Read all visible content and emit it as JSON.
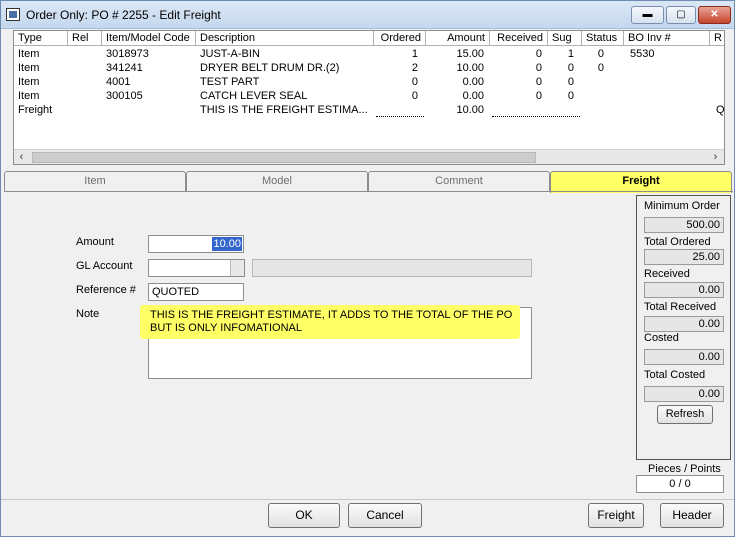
{
  "window": {
    "title": "Order Only: PO # 2255  - Edit Freight",
    "min_label": "▬",
    "max_label": "▢",
    "close_label": "✕"
  },
  "grid": {
    "columns": [
      "Type",
      "Rel",
      "Item/Model Code",
      "Description",
      "Ordered",
      "Amount",
      "Received",
      "Sug",
      "Status",
      "BO Inv #",
      "R"
    ],
    "rows": [
      {
        "type": "Item",
        "rel": "",
        "item_code": "3018973",
        "description": "JUST-A-BIN",
        "ordered": "1",
        "amount": "15.00",
        "received": "0",
        "sug": "1",
        "status": "0",
        "bo_inv": "5530",
        "r": ""
      },
      {
        "type": "Item",
        "rel": "",
        "item_code": "341241",
        "description": "DRYER BELT DRUM DR.(2)",
        "ordered": "2",
        "amount": "10.00",
        "received": "0",
        "sug": "0",
        "status": "0",
        "bo_inv": "",
        "r": ""
      },
      {
        "type": "Item",
        "rel": "",
        "item_code": "4001",
        "description": "TEST PART",
        "ordered": "0",
        "amount": "0.00",
        "received": "0",
        "sug": "0",
        "status": "",
        "bo_inv": "",
        "r": ""
      },
      {
        "type": "Item",
        "rel": "",
        "item_code": "300105",
        "description": "CATCH LEVER SEAL",
        "ordered": "0",
        "amount": "0.00",
        "received": "0",
        "sug": "0",
        "status": "",
        "bo_inv": "",
        "r": ""
      },
      {
        "type": "Freight",
        "rel": "",
        "item_code": "",
        "description": "THIS IS THE FREIGHT ESTIMA...",
        "ordered": "",
        "amount": "10.00",
        "received": "",
        "sug": "",
        "status": "",
        "bo_inv": "",
        "r": "Q"
      }
    ],
    "scroll_left": "‹",
    "scroll_right": "›"
  },
  "tabs": [
    {
      "label": "Item",
      "active": false
    },
    {
      "label": "Model",
      "active": false
    },
    {
      "label": "Comment",
      "active": false
    },
    {
      "label": "Freight",
      "active": true
    }
  ],
  "form": {
    "amount_label": "Amount",
    "amount_value": "10.00",
    "gl_label": "GL Account",
    "gl_value": "",
    "ref_label": "Reference #",
    "ref_value": "QUOTED",
    "note_label": "Note",
    "note_line1": "THIS IS THE FREIGHT ESTIMATE, IT ADDS TO THE TOTAL OF THE PO",
    "note_line2": "BUT IS ONLY INFOMATIONAL"
  },
  "side": {
    "min_order_label": "Minimum Order",
    "min_order_value": "500.00",
    "total_ordered_label": "Total Ordered",
    "total_ordered_value": "25.00",
    "received_label": "Received",
    "received_value": "0.00",
    "total_received_label": "Total Received",
    "total_received_value": "0.00",
    "costed_label": "Costed",
    "costed_value": "0.00",
    "total_costed_label": "Total Costed",
    "total_costed_value": "0.00",
    "refresh_label": "Refresh",
    "pieces_label": "Pieces / Points",
    "pieces_value": "0 / 0"
  },
  "buttons": {
    "ok": "OK",
    "cancel": "Cancel",
    "freight": "Freight",
    "header": "Header"
  },
  "colors": {
    "highlight": "#ffff66",
    "selection": "#3366cc"
  }
}
